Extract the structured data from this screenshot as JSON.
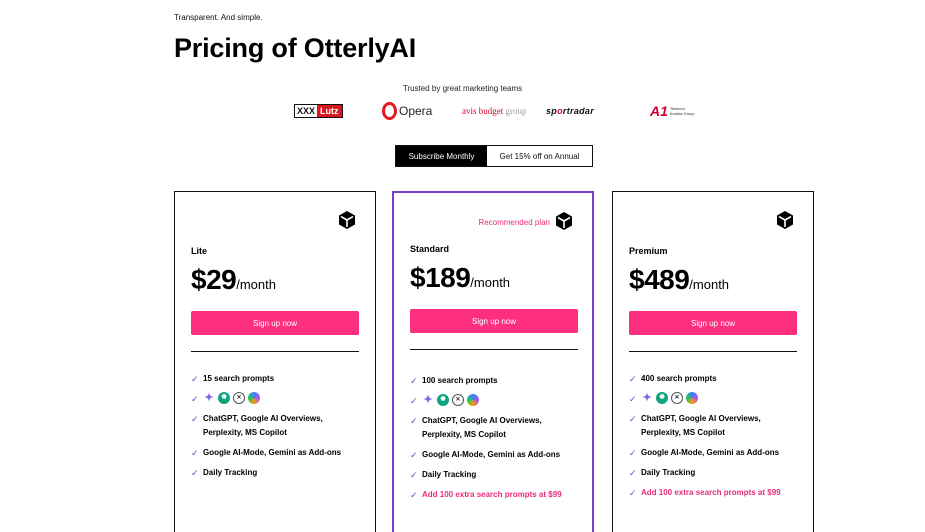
{
  "header": {
    "tagline": "Transparent. And simple.",
    "title": "Pricing of OtterlyAI",
    "trusted": "Trusted by great marketing teams"
  },
  "logos": {
    "xxxlutz_a": "XXX",
    "xxxlutz_b": "Lutz",
    "opera": "Opera",
    "avis_a": "avis",
    "avis_b": "budget",
    "avis_c": "group",
    "sport_a": "sp",
    "sport_b": "o",
    "sport_c": "rtradar",
    "a1_mark": "A1",
    "a1_text": "Telekom Austria Group"
  },
  "toggle": {
    "monthly": "Subscribe Monthly",
    "annual": "Get 15% off on Annual"
  },
  "plans": [
    {
      "name": "Lite",
      "price": "$29",
      "per": "/month",
      "cta": "Sign up now",
      "features": [
        "15 search prompts",
        "ChatGPT, Google AI Overviews, Perplexity, MS Copilot",
        "Google AI-Mode, Gemini as Add-ons",
        "Daily Tracking"
      ]
    },
    {
      "name": "Standard",
      "badge": "Recommended plan",
      "price": "$189",
      "per": "/month",
      "cta": "Sign up now",
      "features": [
        "100 search prompts",
        "ChatGPT, Google AI Overviews, Perplexity, MS Copilot",
        "Google AI-Mode, Gemini as Add-ons",
        "Daily Tracking"
      ],
      "addon": "Add 100 extra search prompts at $99"
    },
    {
      "name": "Premium",
      "price": "$489",
      "per": "/month",
      "cta": "Sign up now",
      "features": [
        "400 search prompts",
        "ChatGPT, Google AI Overviews, Perplexity, MS Copilot",
        "Google AI-Mode, Gemini as Add-ons",
        "Daily Tracking"
      ],
      "addon": "Add 100 extra search prompts at $99"
    }
  ],
  "icons": {
    "check": "✓",
    "gemini": "✦",
    "perplexity": "✕"
  },
  "colors": {
    "accent_pink": "#ff2f7f",
    "recommended_border": "#7a3fc8"
  }
}
